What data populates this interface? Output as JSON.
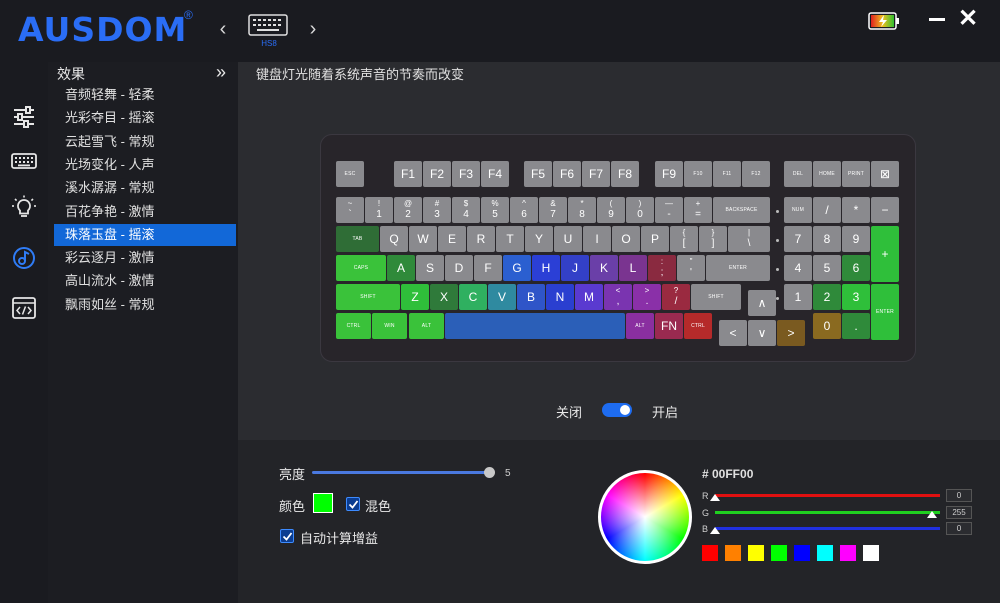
{
  "brand": {
    "name": "AUSDOM",
    "reg": "®"
  },
  "device": {
    "name": "HS8"
  },
  "effects": {
    "title": "效果",
    "items": [
      "音频轻舞 - 轻柔",
      "光彩夺目 - 摇滚",
      "云起雪飞 - 常规",
      "光场变化 - 人声",
      "溪水潺潺 - 常规",
      "百花争艳 - 激情",
      "珠落玉盘 - 摇滚",
      "彩云逐月 - 激情",
      "高山流水 - 激情",
      "飘雨如丝 - 常规"
    ],
    "active_index": 6
  },
  "main": {
    "description": "键盘灯光随着系统声音的节奏而改变"
  },
  "keyboard": {
    "keys": [
      {
        "sub": "",
        "main": "ESC",
        "color": "#8a8a8e"
      },
      {
        "sub": "",
        "main": "F1",
        "color": "#8a8a8e"
      },
      {
        "sub": "",
        "main": "F2",
        "color": "#8a8a8e"
      },
      {
        "sub": "",
        "main": "F3",
        "color": "#8a8a8e"
      },
      {
        "sub": "",
        "main": "F4",
        "color": "#8a8a8e"
      },
      {
        "sub": "",
        "main": "F5",
        "color": "#8a8a8e"
      },
      {
        "sub": "",
        "main": "F6",
        "color": "#8a8a8e"
      },
      {
        "sub": "",
        "main": "F7",
        "color": "#8a8a8e"
      },
      {
        "sub": "",
        "main": "F8",
        "color": "#8a8a8e"
      },
      {
        "sub": "",
        "main": "F9",
        "color": "#8a8a8e"
      },
      {
        "sub": "",
        "main": "F10",
        "color": "#8a8a8e"
      },
      {
        "sub": "",
        "main": "F11",
        "color": "#8a8a8e"
      },
      {
        "sub": "",
        "main": "F12",
        "color": "#8a8a8e"
      },
      {
        "sub": "",
        "main": "DEL",
        "color": "#8a8a8e"
      },
      {
        "sub": "",
        "main": "HOME",
        "color": "#8a8a8e"
      },
      {
        "sub": "",
        "main": "PRINT",
        "color": "#8a8a8e"
      },
      {
        "sub": "",
        "main": "⊠",
        "color": "#8a8a8e"
      },
      {
        "sub": "~",
        "main": "`",
        "color": "#8a8a8e"
      },
      {
        "sub": "!",
        "main": "1",
        "color": "#8a8a8e"
      },
      {
        "sub": "@",
        "main": "2",
        "color": "#8a8a8e"
      },
      {
        "sub": "#",
        "main": "3",
        "color": "#8a8a8e"
      },
      {
        "sub": "$",
        "main": "4",
        "color": "#8a8a8e"
      },
      {
        "sub": "%",
        "main": "5",
        "color": "#8a8a8e"
      },
      {
        "sub": "^",
        "main": "6",
        "color": "#8a8a8e"
      },
      {
        "sub": "&",
        "main": "7",
        "color": "#8a8a8e"
      },
      {
        "sub": "*",
        "main": "8",
        "color": "#8a8a8e"
      },
      {
        "sub": "(",
        "main": "9",
        "color": "#8a8a8e"
      },
      {
        "sub": ")",
        "main": "0",
        "color": "#8a8a8e"
      },
      {
        "sub": "—",
        "main": "-",
        "color": "#8a8a8e"
      },
      {
        "sub": "+",
        "main": "=",
        "color": "#8a8a8e"
      },
      {
        "sub": "",
        "main": "BACKSPACE",
        "color": "#8a8a8e"
      },
      {
        "sub": "",
        "main": "NUM",
        "color": "#8a8a8e"
      },
      {
        "sub": "",
        "main": "/",
        "color": "#8a8a8e"
      },
      {
        "sub": "",
        "main": "*",
        "color": "#8a8a8e"
      },
      {
        "sub": "",
        "main": "−",
        "color": "#8a8a8e"
      },
      {
        "sub": "",
        "main": "TAB",
        "color": "#2f6d36"
      },
      {
        "sub": "",
        "main": "Q",
        "color": "#8a8a8e"
      },
      {
        "sub": "",
        "main": "W",
        "color": "#8a8a8e"
      },
      {
        "sub": "",
        "main": "E",
        "color": "#8a8a8e"
      },
      {
        "sub": "",
        "main": "R",
        "color": "#8a8a8e"
      },
      {
        "sub": "",
        "main": "T",
        "color": "#8a8a8e"
      },
      {
        "sub": "",
        "main": "Y",
        "color": "#8a8a8e"
      },
      {
        "sub": "",
        "main": "U",
        "color": "#8a8a8e"
      },
      {
        "sub": "",
        "main": "I",
        "color": "#8a8a8e"
      },
      {
        "sub": "",
        "main": "O",
        "color": "#8a8a8e"
      },
      {
        "sub": "",
        "main": "P",
        "color": "#8a8a8e"
      },
      {
        "sub": "{",
        "main": "[",
        "color": "#8a8a8e"
      },
      {
        "sub": "}",
        "main": "]",
        "color": "#8a8a8e"
      },
      {
        "sub": "|",
        "main": "\\",
        "color": "#8a8a8e"
      },
      {
        "sub": "",
        "main": "7",
        "color": "#8a8a8e"
      },
      {
        "sub": "",
        "main": "8",
        "color": "#8a8a8e"
      },
      {
        "sub": "",
        "main": "9",
        "color": "#8a8a8e"
      },
      {
        "sub": "",
        "main": "+",
        "color": "#2fbf3a"
      },
      {
        "sub": "",
        "main": "CAPS",
        "color": "#3ac23a"
      },
      {
        "sub": "",
        "main": "A",
        "color": "#2f8a3a"
      },
      {
        "sub": "",
        "main": "S",
        "color": "#8a8a8e"
      },
      {
        "sub": "",
        "main": "D",
        "color": "#8a8a8e"
      },
      {
        "sub": "",
        "main": "F",
        "color": "#8a8a8e"
      },
      {
        "sub": "",
        "main": "G",
        "color": "#2b5fd0"
      },
      {
        "sub": "",
        "main": "H",
        "color": "#2b3fd6"
      },
      {
        "sub": "",
        "main": "J",
        "color": "#3340c8"
      },
      {
        "sub": "",
        "main": "K",
        "color": "#6a3fa8"
      },
      {
        "sub": "",
        "main": "L",
        "color": "#7a3490"
      },
      {
        "sub": ":",
        "main": ";",
        "color": "#8a2a40"
      },
      {
        "sub": "\"",
        "main": "'",
        "color": "#8a8a8e"
      },
      {
        "sub": "",
        "main": "ENTER",
        "color": "#8a8a8e"
      },
      {
        "sub": "",
        "main": "4",
        "color": "#8a8a8e"
      },
      {
        "sub": "",
        "main": "5",
        "color": "#8a8a8e"
      },
      {
        "sub": "",
        "main": "6",
        "color": "#2f8a3a"
      },
      {
        "sub": "",
        "main": "SHIFT",
        "color": "#3ac23a"
      },
      {
        "sub": "",
        "main": "Z",
        "color": "#2fbf3a"
      },
      {
        "sub": "",
        "main": "X",
        "color": "#2f7a3a"
      },
      {
        "sub": "",
        "main": "C",
        "color": "#2fb060"
      },
      {
        "sub": "",
        "main": "V",
        "color": "#2f8aa0"
      },
      {
        "sub": "",
        "main": "B",
        "color": "#2f55c8"
      },
      {
        "sub": "",
        "main": "N",
        "color": "#2a3fd0"
      },
      {
        "sub": "",
        "main": "M",
        "color": "#5a3ad0"
      },
      {
        "sub": "<",
        "main": ",",
        "color": "#7a34b0"
      },
      {
        "sub": ">",
        "main": ".",
        "color": "#8a30a8"
      },
      {
        "sub": "?",
        "main": "/",
        "color": "#9a2a40"
      },
      {
        "sub": "",
        "main": "SHIFT",
        "color": "#8a8a8e"
      },
      {
        "sub": "",
        "main": "∧",
        "color": "#8a8a8e"
      },
      {
        "sub": "",
        "main": "1",
        "color": "#8a8a8e"
      },
      {
        "sub": "",
        "main": "2",
        "color": "#2f8a3a"
      },
      {
        "sub": "",
        "main": "3",
        "color": "#2fbf3a"
      },
      {
        "sub": "",
        "main": "ENTER",
        "color": "#2fbf3a"
      },
      {
        "sub": "",
        "main": "CTRL",
        "color": "#3ac23a"
      },
      {
        "sub": "",
        "main": "WIN",
        "color": "#3ac23a"
      },
      {
        "sub": "",
        "main": "ALT",
        "color": "#3ac23a"
      },
      {
        "sub": "",
        "main": "",
        "color": "#2b5fb8"
      },
      {
        "sub": "",
        "main": "ALT",
        "color": "#8a2fa0"
      },
      {
        "sub": "",
        "main": "FN",
        "color": "#9a2a50"
      },
      {
        "sub": "",
        "main": "CTRL",
        "color": "#b52a2a"
      },
      {
        "sub": "",
        "main": "<",
        "color": "#8a8a8e"
      },
      {
        "sub": "",
        "main": "∨",
        "color": "#8a8a8e"
      },
      {
        "sub": "",
        "main": ">",
        "color": "#7a5a20"
      },
      {
        "sub": "",
        "main": "0",
        "color": "#8a6a20"
      },
      {
        "sub": "",
        "main": ".",
        "color": "#2f8a3a"
      }
    ]
  },
  "light_toggle": {
    "off_label": "关闭",
    "on_label": "开启",
    "state": "on"
  },
  "controls": {
    "brightness_label": "亮度",
    "brightness_value": "5",
    "brightness_fraction": 1.0,
    "color_label": "颜色",
    "color_value": "#00ff00",
    "mix_label": "混色",
    "mix_checked": true,
    "auto_gain_label": "自动计算增益",
    "auto_gain_checked": true
  },
  "color_picker": {
    "hex": "# 00FF00",
    "r_label": "R",
    "r_value": "0",
    "r_fraction": 0.0,
    "r_color": "#e01010",
    "g_label": "G",
    "g_value": "255",
    "g_fraction": 1.0,
    "g_color": "#20d020",
    "b_label": "B",
    "b_value": "0",
    "b_fraction": 0.0,
    "b_color": "#2030e0",
    "presets": [
      "#ff0000",
      "#ff8000",
      "#ffff00",
      "#00ff00",
      "#0000ff",
      "#00ffff",
      "#ff00ff",
      "#ffffff"
    ]
  }
}
